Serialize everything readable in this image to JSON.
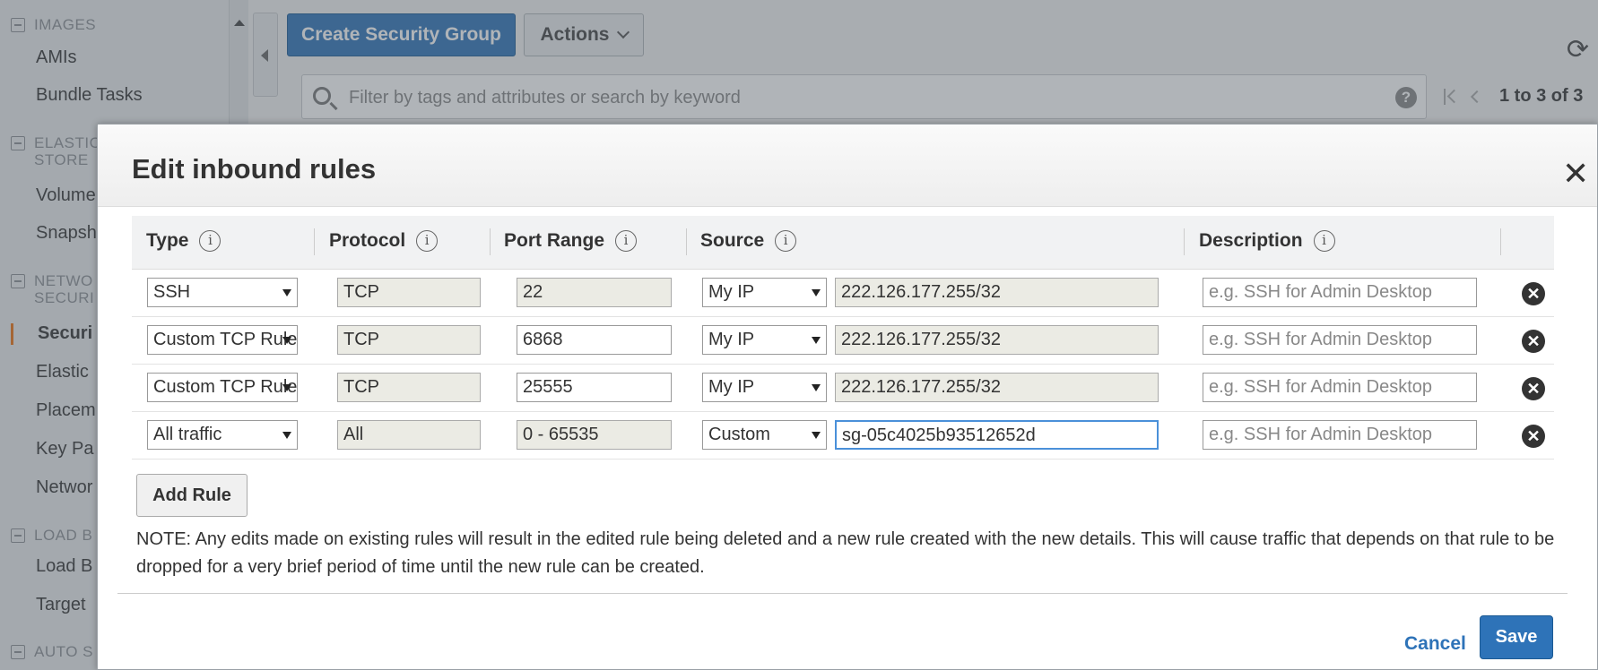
{
  "sidebar": {
    "sections": [
      {
        "label": "IMAGES"
      },
      {
        "label": "ELASTIC BLOCK STORE",
        "line1": "ELASTIC",
        "line2": "STORE"
      },
      {
        "label": "NETWORK & SECURITY",
        "line1": "NETWO",
        "line2": "SECURI"
      },
      {
        "label": "LOAD BALANCING",
        "line1": "LOAD B"
      },
      {
        "label": "AUTO SCALING",
        "line1": "AUTO S"
      }
    ],
    "items": {
      "amis": "AMIs",
      "bundle_tasks": "Bundle Tasks",
      "volumes": "Volume",
      "snapshots": "Snapsh",
      "security_groups": "Securi",
      "elastic_ips": "Elastic",
      "placement": "Placem",
      "key_pairs": "Key Pa",
      "network_interfaces": "Networ",
      "load_balancers": "Load B",
      "target_groups": "Target"
    }
  },
  "toolbar": {
    "create_label": "Create Security Group",
    "actions_label": "Actions",
    "refresh_glyph": "⟳"
  },
  "search": {
    "placeholder": "Filter by tags and attributes or search by keyword",
    "help_glyph": "?"
  },
  "pager": {
    "count": "1 to 3 of 3"
  },
  "modal": {
    "title": "Edit inbound rules",
    "close_glyph": "✕",
    "columns": [
      "Type",
      "Protocol",
      "Port Range",
      "Source",
      "Description"
    ],
    "info_glyph": "i",
    "rules": [
      {
        "type": "SSH",
        "protocol": "TCP",
        "port": "22",
        "source_type": "My IP",
        "source": "222.126.177.255/32",
        "description_placeholder": "e.g. SSH for Admin Desktop"
      },
      {
        "type": "Custom TCP Rule",
        "protocol": "TCP",
        "port": "6868",
        "source_type": "My IP",
        "source": "222.126.177.255/32",
        "description_placeholder": "e.g. SSH for Admin Desktop"
      },
      {
        "type": "Custom TCP Rule",
        "protocol": "TCP",
        "port": "25555",
        "source_type": "My IP",
        "source": "222.126.177.255/32",
        "description_placeholder": "e.g. SSH for Admin Desktop"
      },
      {
        "type": "All traffic",
        "protocol": "All",
        "port": "0 - 65535",
        "source_type": "Custom",
        "source": "sg-05c4025b93512652d",
        "description_placeholder": "e.g. SSH for Admin Desktop"
      }
    ],
    "delete_glyph": "✕",
    "add_rule_label": "Add Rule",
    "note": "NOTE: Any edits made on existing rules will result in the edited rule being deleted and a new rule created with the new details. This will cause traffic that depends on that rule to be dropped for a very brief period of time until the new rule can be created.",
    "cancel_label": "Cancel",
    "save_label": "Save"
  },
  "colors": {
    "primary": "#2e73b8",
    "active_accent": "#ec7211",
    "focus": "#4a90d9"
  }
}
